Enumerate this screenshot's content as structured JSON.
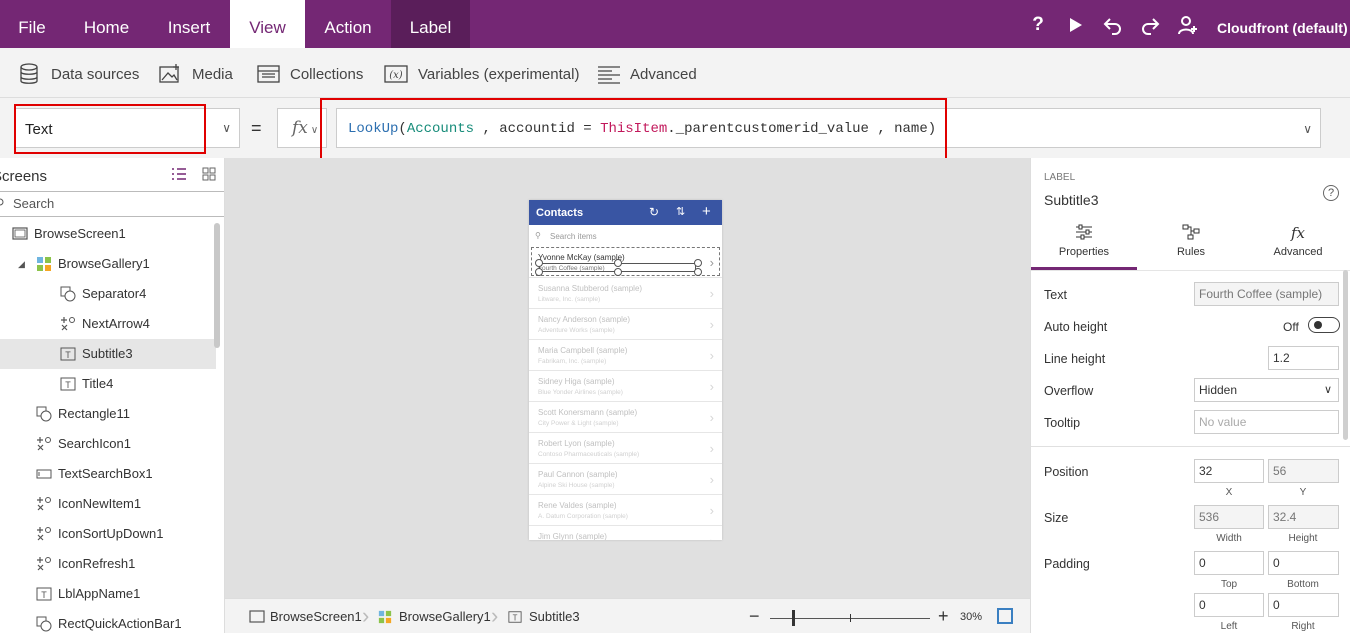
{
  "menu": {
    "tabs": [
      "File",
      "Home",
      "Insert",
      "View",
      "Action",
      "Label"
    ],
    "active": "View",
    "environment": "Cloudfront (default)"
  },
  "ribbon": {
    "items": [
      "Data sources",
      "Media",
      "Collections",
      "Variables (experimental)",
      "Advanced"
    ]
  },
  "formula_bar": {
    "property": "Text",
    "equals": "=",
    "fx": "fx",
    "formula_parts": [
      "LookUp",
      "(",
      "Accounts",
      " , accountid = ",
      "ThisItem",
      "._parentcustomerid_value , name)"
    ]
  },
  "tree": {
    "title": "Screens",
    "search_placeholder": "Search",
    "items": [
      {
        "label": "BrowseScreen1",
        "icon": "screen-icon"
      },
      {
        "label": "BrowseGallery1",
        "icon": "gallery-icon"
      },
      {
        "label": "Separator4",
        "icon": "shape-icon"
      },
      {
        "label": "NextArrow4",
        "icon": "icon-control-icon"
      },
      {
        "label": "Subtitle3",
        "icon": "label-icon"
      },
      {
        "label": "Title4",
        "icon": "label-icon"
      },
      {
        "label": "Rectangle11",
        "icon": "shape-icon"
      },
      {
        "label": "SearchIcon1",
        "icon": "icon-control-icon"
      },
      {
        "label": "TextSearchBox1",
        "icon": "textinput-icon"
      },
      {
        "label": "IconNewItem1",
        "icon": "icon-control-icon"
      },
      {
        "label": "IconSortUpDown1",
        "icon": "icon-control-icon"
      },
      {
        "label": "IconRefresh1",
        "icon": "icon-control-icon"
      },
      {
        "label": "LblAppName1",
        "icon": "label-icon"
      },
      {
        "label": "RectQuickActionBar1",
        "icon": "shape-icon"
      }
    ],
    "selected": "Subtitle3"
  },
  "app_preview": {
    "title": "Contacts",
    "search_placeholder": "Search items",
    "rows": [
      {
        "name": "Yvonne McKay (sample)",
        "sub": "Fourth Coffee (sample)"
      },
      {
        "name": "Susanna Stubberod (sample)",
        "sub": "Litware, Inc. (sample)"
      },
      {
        "name": "Nancy Anderson (sample)",
        "sub": "Adventure Works (sample)"
      },
      {
        "name": "Maria Campbell (sample)",
        "sub": "Fabrikam, Inc. (sample)"
      },
      {
        "name": "Sidney Higa (sample)",
        "sub": "Blue Yonder Airlines (sample)"
      },
      {
        "name": "Scott Konersmann (sample)",
        "sub": "City Power & Light (sample)"
      },
      {
        "name": "Robert Lyon (sample)",
        "sub": "Contoso Pharmaceuticals (sample)"
      },
      {
        "name": "Paul Cannon (sample)",
        "sub": "Alpine Ski House (sample)"
      },
      {
        "name": "Rene Valdes (sample)",
        "sub": "A. Datum Corporation (sample)"
      },
      {
        "name": "Jim Glynn (sample)",
        "sub": ""
      }
    ]
  },
  "status_bar": {
    "breadcrumbs": [
      "BrowseScreen1",
      "BrowseGallery1",
      "Subtitle3"
    ],
    "zoom": "30%"
  },
  "properties_panel": {
    "type": "LABEL",
    "name": "Subtitle3",
    "tabs": [
      "Properties",
      "Rules",
      "Advanced"
    ],
    "active_tab": "Properties",
    "text_label": "Text",
    "text_value": "Fourth Coffee (sample)",
    "autoheight_label": "Auto height",
    "autoheight_value": "Off",
    "lineheight_label": "Line height",
    "lineheight_value": "1.2",
    "overflow_label": "Overflow",
    "overflow_value": "Hidden",
    "tooltip_label": "Tooltip",
    "tooltip_placeholder": "No value",
    "position_label": "Position",
    "position_x": "32",
    "position_y": "56",
    "x_label": "X",
    "y_label": "Y",
    "size_label": "Size",
    "width": "536",
    "height": "32.4",
    "width_label": "Width",
    "height_label": "Height",
    "padding_label": "Padding",
    "padding_top": "0",
    "padding_bottom": "0",
    "padding_left": "0",
    "padding_right": "0",
    "top_label": "Top",
    "bottom_label": "Bottom",
    "left_label": "Left",
    "right_label": "Right"
  },
  "colors": {
    "brand": "#742774",
    "header_blue": "#3955a3",
    "highlight": "#e00000"
  }
}
